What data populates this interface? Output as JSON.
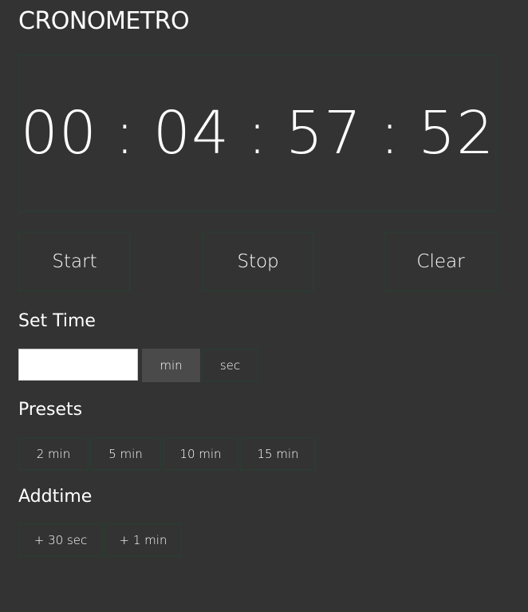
{
  "app": {
    "title": "CRONOMETRO"
  },
  "display": {
    "hours": "00",
    "minutes": "04",
    "seconds": "57",
    "hundredths": "52",
    "separator": ":"
  },
  "controls": {
    "start_label": "Start",
    "stop_label": "Stop",
    "clear_label": "Clear"
  },
  "set_time": {
    "label": "Set Time",
    "input_value": "",
    "unit_min": "min",
    "unit_sec": "sec",
    "selected_unit": "min"
  },
  "presets": {
    "label": "Presets",
    "items": [
      "2 min",
      "5 min",
      "10 min",
      "15 min"
    ]
  },
  "addtime": {
    "label": "Addtime",
    "items": [
      "+ 30 sec",
      "+ 1 min"
    ]
  },
  "colors": {
    "background": "#333333",
    "border": "#2c3a32",
    "selected_unit_bg": "#4a4a4a",
    "text": "#ffffff"
  }
}
